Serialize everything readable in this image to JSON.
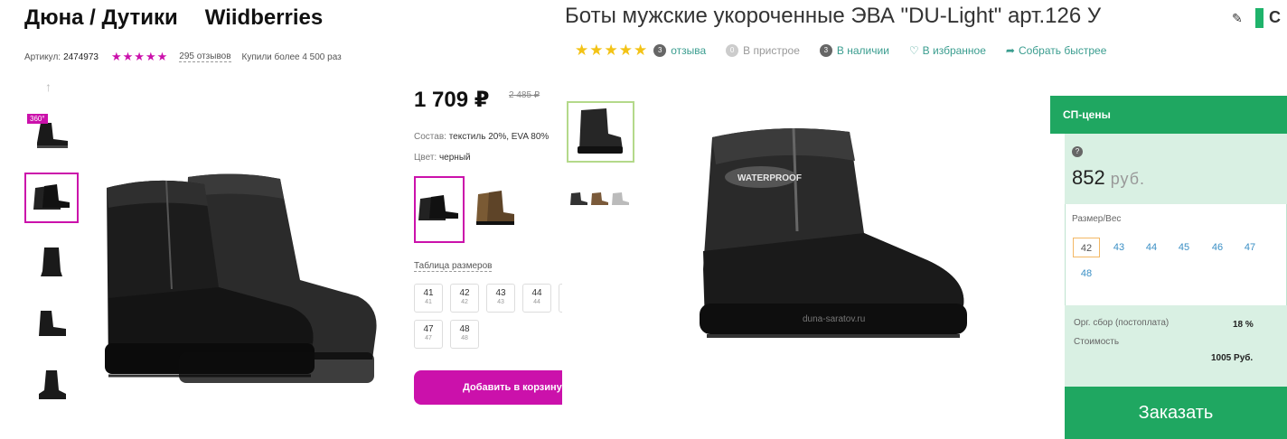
{
  "left": {
    "store_title": "Дюна / Дутики",
    "brand": "Wiidberries",
    "article_label": "Артикул:",
    "article_value": "2474973",
    "rating_stars": "★★★★★",
    "reviews": "295 отзывов",
    "bought": "Купили более 4 500 раз",
    "badge_360": "360°",
    "price": "1 709 ₽",
    "old_price": "2 485 ₽",
    "composition_label": "Состав:",
    "composition_value": "текстиль 20%, EVA 80%",
    "color_label": "Цвет:",
    "color_value": "черный",
    "size_table_label": "Таблица размеров",
    "sizes": [
      {
        "main": "41",
        "sub": "41"
      },
      {
        "main": "42",
        "sub": "42"
      },
      {
        "main": "43",
        "sub": "43"
      },
      {
        "main": "44",
        "sub": "44"
      },
      {
        "main": "47",
        "sub": "47"
      },
      {
        "main": "48",
        "sub": "48"
      }
    ],
    "add_to_cart": "Добавить в корзину",
    "accent_color": "#cb11ab"
  },
  "right": {
    "title": "Боты мужские укороченные ЭВА \"DU-Light\" арт.126 У",
    "cut_letter": "С",
    "stars": "★★★★★",
    "reviews_count": "3",
    "reviews_label": "отзыва",
    "transit_count": "0",
    "transit_label": "В пристрое",
    "stock_count": "3",
    "stock_label": "В наличии",
    "favorite_label": "В избранное",
    "compare_label": "Собрать быстрее",
    "watermark": "duna-saratov.ru",
    "sp_prices_label": "СП-цены",
    "price_value": "852",
    "price_currency": "руб.",
    "size_weight_label": "Размер/Вес",
    "sizes": [
      "42",
      "43",
      "44",
      "45",
      "46",
      "47",
      "48"
    ],
    "selected_size": "42",
    "fee_label": "Орг. сбор (постоплата)",
    "fee_value": "18 %",
    "cost_label": "Стоимость",
    "cost_value": "1005 Руб.",
    "order_button": "Заказать",
    "accent_color": "#1fa761"
  }
}
